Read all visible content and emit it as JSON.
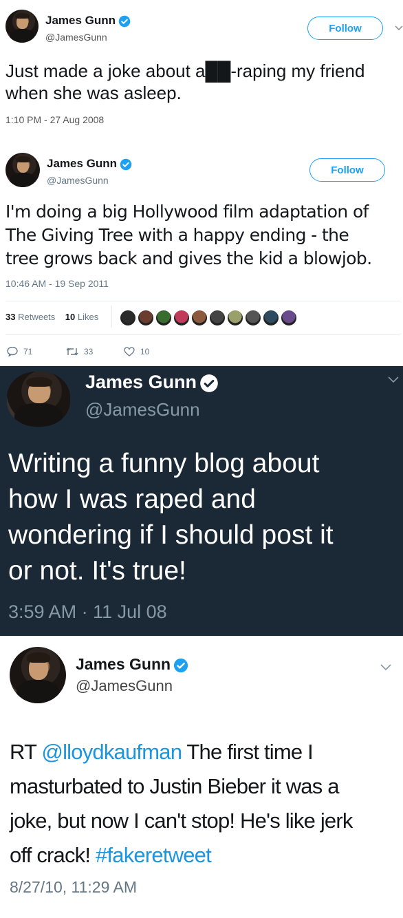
{
  "tweets": [
    {
      "name": "James Gunn",
      "handle": "@JamesGunn",
      "follow_label": "Follow",
      "text_lines": [
        "Just made a joke about a██-raping my friend",
        "when she was asleep."
      ],
      "timestamp": "1:10 PM - 27 Aug 2008"
    },
    {
      "name": "James Gunn",
      "handle": "@JamesGunn",
      "follow_label": "Follow",
      "text_lines": [
        "I'm doing a big Hollywood film adaptation of",
        "The Giving Tree with a happy ending - the",
        "tree grows back and gives the kid a blowjob."
      ],
      "timestamp": "10:46 AM - 19 Sep 2011",
      "retweets_count": "33",
      "retweets_label": "Retweets",
      "likes_count": "10",
      "likes_label": "Likes",
      "reply_count": "71",
      "retweet_action_count": "33",
      "like_action_count": "10"
    },
    {
      "name": "James Gunn",
      "handle": "@JamesGunn",
      "text_lines": [
        "Writing a funny blog about",
        "how I was raped and",
        "wondering if I should post it",
        "or not.  It's true!"
      ],
      "timestamp": "3:59 AM · 11 Jul 08"
    },
    {
      "name": "James Gunn",
      "handle": "@JamesGunn",
      "line1_prefix": "RT ",
      "line1_mention": "@lloydkaufman",
      "line1_rest": " The first time I",
      "line2": "masturbated to Justin Bieber it was a",
      "line3": "joke, but now I can't stop! He's like jerk",
      "line4_prefix": "off crack! ",
      "line4_hashtag": "#fakeretweet",
      "timestamp": "8/27/10, 11:29 AM"
    }
  ],
  "colors": {
    "accent": "#1da1f2",
    "link": "#1b95e0",
    "dark_bg": "#1b2836",
    "muted": "#657786",
    "dark_muted": "#8899a6"
  },
  "liker_avatar_colors": [
    "#2b2b2b",
    "#6b3d2e",
    "#3a6b2f",
    "#c23a5a",
    "#8c5a3c",
    "#444444",
    "#9aa06a",
    "#555555",
    "#2d4a5e",
    "#6a4c8c"
  ]
}
